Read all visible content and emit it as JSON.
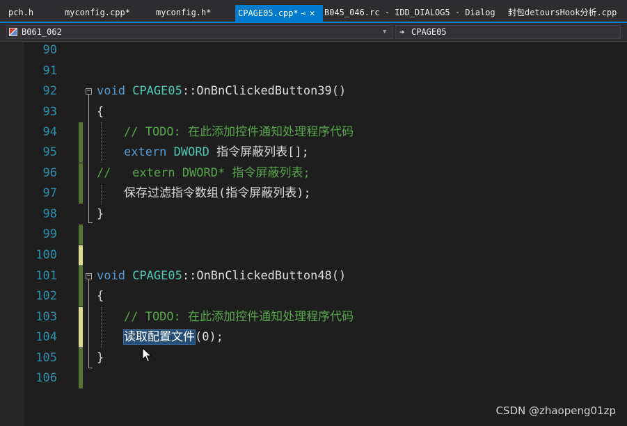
{
  "tabs": [
    {
      "label": "pch.h"
    },
    {
      "label": "myconfig.cpp*"
    },
    {
      "label": "myconfig.h*"
    },
    {
      "label": "CPAGE05.cpp*",
      "active": true
    },
    {
      "label": "B045_046.rc - IDD_DIALOG5 - Dialog"
    },
    {
      "label": "封包detoursHook分析.cpp"
    }
  ],
  "tab_pin_icon": "pin-icon",
  "tab_close_icon": "close-icon",
  "nav": {
    "project": "B061_062",
    "scope": "CPAGE05",
    "scope_icon": "arrow-right-icon"
  },
  "colors": {
    "accent": "#007acc",
    "keyword": "#569cd6",
    "type": "#4ec9b0",
    "comment": "#57a64a",
    "line_number": "#2b91af",
    "selection": "#264f78"
  },
  "code": {
    "l90": {
      "num": "90"
    },
    "l91": {
      "num": "91"
    },
    "l92": {
      "num": "92",
      "kw": "void",
      "cls": "CPAGE05",
      "rest": "::OnBnClickedButton39()"
    },
    "l93": {
      "num": "93",
      "text": "{"
    },
    "l94": {
      "num": "94",
      "comment": "// TODO: 在此添加控件通知处理程序代码"
    },
    "l95": {
      "num": "95",
      "kw": "extern",
      "type": "DWORD",
      "rest": " 指令屏蔽列表[];"
    },
    "l96": {
      "num": "96",
      "comment": "//   extern DWORD* 指令屏蔽列表;"
    },
    "l97": {
      "num": "97",
      "text": "保存过滤指令数组(指令屏蔽列表);"
    },
    "l98": {
      "num": "98",
      "text": "}"
    },
    "l99": {
      "num": "99"
    },
    "l100": {
      "num": "100"
    },
    "l101": {
      "num": "101",
      "kw": "void",
      "cls": "CPAGE05",
      "rest": "::OnBnClickedButton48()"
    },
    "l102": {
      "num": "102",
      "text": "{"
    },
    "l103": {
      "num": "103",
      "comment": "// TODO: 在此添加控件通知处理程序代码"
    },
    "l104": {
      "num": "104",
      "selected": "读取配置文件",
      "rest": "(0);"
    },
    "l105": {
      "num": "105",
      "text": "}"
    },
    "l106": {
      "num": "106"
    }
  },
  "watermark": "CSDN @zhaopeng01zp"
}
